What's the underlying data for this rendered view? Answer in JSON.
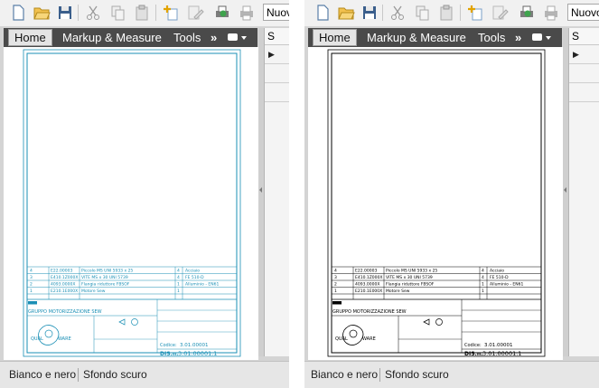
{
  "toolbar": {
    "name_field_value": "Nuovo",
    "icons": [
      "new-file-icon",
      "open-folder-icon",
      "save-icon",
      "cut-icon",
      "copy-icon",
      "paste-icon",
      "add-sheet-icon",
      "edit-icon",
      "print-preview-icon",
      "print-icon"
    ]
  },
  "menu": {
    "tabs": [
      "Home",
      "Markup & Measure",
      "Tools"
    ],
    "overflow": "»"
  },
  "side_panel": {
    "header": "S"
  },
  "drawing": {
    "bom_rows": [
      {
        "pos": "4",
        "code": "E22.00003",
        "desc": "Piccolo MS UNI 5933 x 25",
        "qty": "4",
        "mat": "Acciaio"
      },
      {
        "pos": "3",
        "code": "E410.1Z000X",
        "desc": "VITE MS x 30 UNI 5739",
        "qty": "4",
        "mat": "FE 510-D"
      },
      {
        "pos": "2",
        "code": "4093.0000X",
        "desc": "Flangia riduttore FBSOF",
        "qty": "1",
        "mat": "Alluminio - EN61"
      },
      {
        "pos": "1",
        "code": "E210.1E000X",
        "desc": "Motore Sew",
        "qty": "1",
        "mat": ""
      }
    ],
    "title_block_title": "GRUPPO MOTORIZZAZIONE SEW",
    "company_left": "QUAL",
    "company_right": "WARE",
    "code": "3.01.00001",
    "drawing_number": "3.01.00001.1",
    "code_label": "Codice:",
    "number_label": "DIS.n."
  },
  "status": {
    "left": [
      "Bianco e nero",
      "Sfondo scuro"
    ],
    "right": [
      "Bianco e nero",
      "Sfondo scuro"
    ]
  },
  "colors": {
    "menu_bg": "#4a4a4a",
    "left_drawing_lines": "#1a8fb5",
    "right_drawing_lines": "#000000"
  }
}
